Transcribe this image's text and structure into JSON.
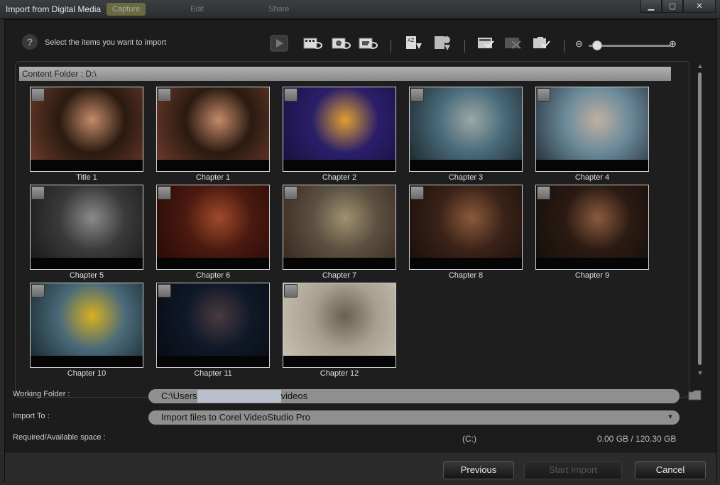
{
  "window": {
    "title": "Import from Digital Media",
    "bg_tabs": [
      "Capture",
      "Edit",
      "Share"
    ],
    "minimize": "▁",
    "maximize": "▢",
    "close": "✕"
  },
  "toolbar": {
    "help_icon": "?",
    "instruction": "Select the items you want to import",
    "icons": [
      "play-icon",
      "clip-view-icon",
      "scene-view-icon",
      "frame-view-icon",
      "sort-by-name-icon",
      "sort-by-date-icon",
      "select-all-icon",
      "deselect-all-icon",
      "mark-icon"
    ],
    "zoom_minus": "⊖",
    "zoom_plus": "⊕",
    "zoom_level": 0.05
  },
  "content": {
    "folder_label": "Content Folder : D:\\",
    "items": [
      {
        "label": "Title 1",
        "colors": [
          "#2a1a10",
          "#c48a6a",
          "#6a3a2a"
        ],
        "checked": false
      },
      {
        "label": "Chapter 1",
        "colors": [
          "#2a1a10",
          "#c48a6a",
          "#6a3a2a"
        ],
        "checked": false
      },
      {
        "label": "Chapter 2",
        "colors": [
          "#2b1f6a",
          "#e0a030",
          "#1a1040"
        ],
        "checked": false
      },
      {
        "label": "Chapter 3",
        "colors": [
          "#4a6a7a",
          "#9aa8a8",
          "#1e2a30"
        ],
        "checked": false
      },
      {
        "label": "Chapter 4",
        "colors": [
          "#6a8a9a",
          "#c0b0a0",
          "#2a3440"
        ],
        "checked": false
      },
      {
        "label": "Chapter 5",
        "colors": [
          "#3a3a3a",
          "#8a8a8a",
          "#1a1a1a"
        ],
        "checked": false
      },
      {
        "label": "Chapter 6",
        "colors": [
          "#4a1a10",
          "#a04a2a",
          "#2a0a08"
        ],
        "checked": false
      },
      {
        "label": "Chapter 7",
        "colors": [
          "#5a5040",
          "#a09070",
          "#3a2a20"
        ],
        "checked": false
      },
      {
        "label": "Chapter 8",
        "colors": [
          "#3a2218",
          "#8a5a3a",
          "#1a100a"
        ],
        "checked": false
      },
      {
        "label": "Chapter 9",
        "colors": [
          "#2a1a12",
          "#8a5a40",
          "#14100c"
        ],
        "checked": false
      },
      {
        "label": "Chapter 10",
        "colors": [
          "#4a6a7a",
          "#d8b020",
          "#1a2a30"
        ],
        "checked": false
      },
      {
        "label": "Chapter 11",
        "colors": [
          "#101828",
          "#4a3a40",
          "#080c14"
        ],
        "checked": false
      },
      {
        "label": "Chapter 12",
        "colors": [
          "#a8a090",
          "#6a6050",
          "#c8c0b0"
        ],
        "checked": false
      }
    ]
  },
  "working_folder": {
    "label": "Working Folder :",
    "value_prefix": "C:\\Users",
    "value_suffix": "videos"
  },
  "import_to": {
    "label": "Import To :",
    "value": "Import files to Corel VideoStudio Pro"
  },
  "space": {
    "label": "Required/Available space :",
    "drive": "(C:)",
    "value": "0.00 GB / 120.30 GB"
  },
  "buttons": {
    "previous": "Previous",
    "start_import": "Start Import",
    "cancel": "Cancel"
  },
  "colors": {
    "accent": "#d8b020",
    "panel": "#1e1e1e"
  }
}
